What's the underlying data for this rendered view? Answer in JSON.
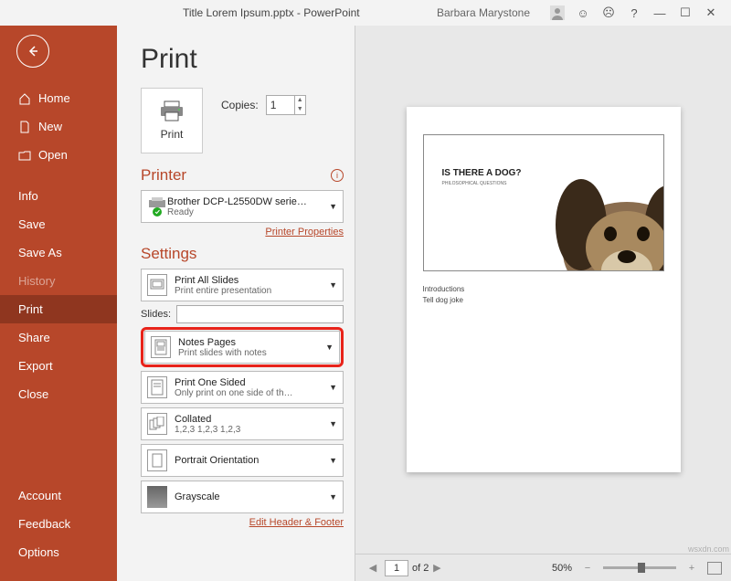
{
  "titlebar": {
    "doc_title": "Title Lorem Ipsum.pptx - PowerPoint",
    "user": "Barbara Marystone"
  },
  "sidebar": {
    "items": [
      {
        "label": "Home",
        "icon": "home"
      },
      {
        "label": "New",
        "icon": "new"
      },
      {
        "label": "Open",
        "icon": "open"
      }
    ],
    "items2": [
      {
        "label": "Info"
      },
      {
        "label": "Save"
      },
      {
        "label": "Save As"
      },
      {
        "label": "History",
        "faded": true
      },
      {
        "label": "Print",
        "selected": true
      },
      {
        "label": "Share"
      },
      {
        "label": "Export"
      },
      {
        "label": "Close"
      }
    ],
    "items3": [
      {
        "label": "Account"
      },
      {
        "label": "Feedback"
      },
      {
        "label": "Options"
      }
    ]
  },
  "page": {
    "title": "Print",
    "print_btn": "Print",
    "copies_label": "Copies:",
    "copies_value": "1",
    "printer_heading": "Printer",
    "printer_name": "Brother DCP-L2550DW serie…",
    "printer_status": "Ready",
    "printer_props": "Printer Properties",
    "settings_heading": "Settings",
    "slides_label": "Slides:",
    "edit_hf": "Edit Header & Footer",
    "dd": [
      {
        "l1": "Print All Slides",
        "l2": "Print entire presentation"
      },
      {
        "l1": "Notes Pages",
        "l2": "Print slides with notes"
      },
      {
        "l1": "Print One Sided",
        "l2": "Only print on one side of th…"
      },
      {
        "l1": "Collated",
        "l2": "1,2,3   1,2,3   1,2,3"
      },
      {
        "l1": "Portrait Orientation",
        "l2": ""
      },
      {
        "l1": "Grayscale",
        "l2": ""
      }
    ]
  },
  "preview": {
    "slide_title": "IS THERE A DOG?",
    "slide_sub": "PHILOSOPHICAL QUESTIONS",
    "notes1": "Introductions",
    "notes2": "Tell  dog joke",
    "page_current": "1",
    "page_total": "of 2",
    "zoom": "50%"
  },
  "watermark": "wsxdn.com"
}
